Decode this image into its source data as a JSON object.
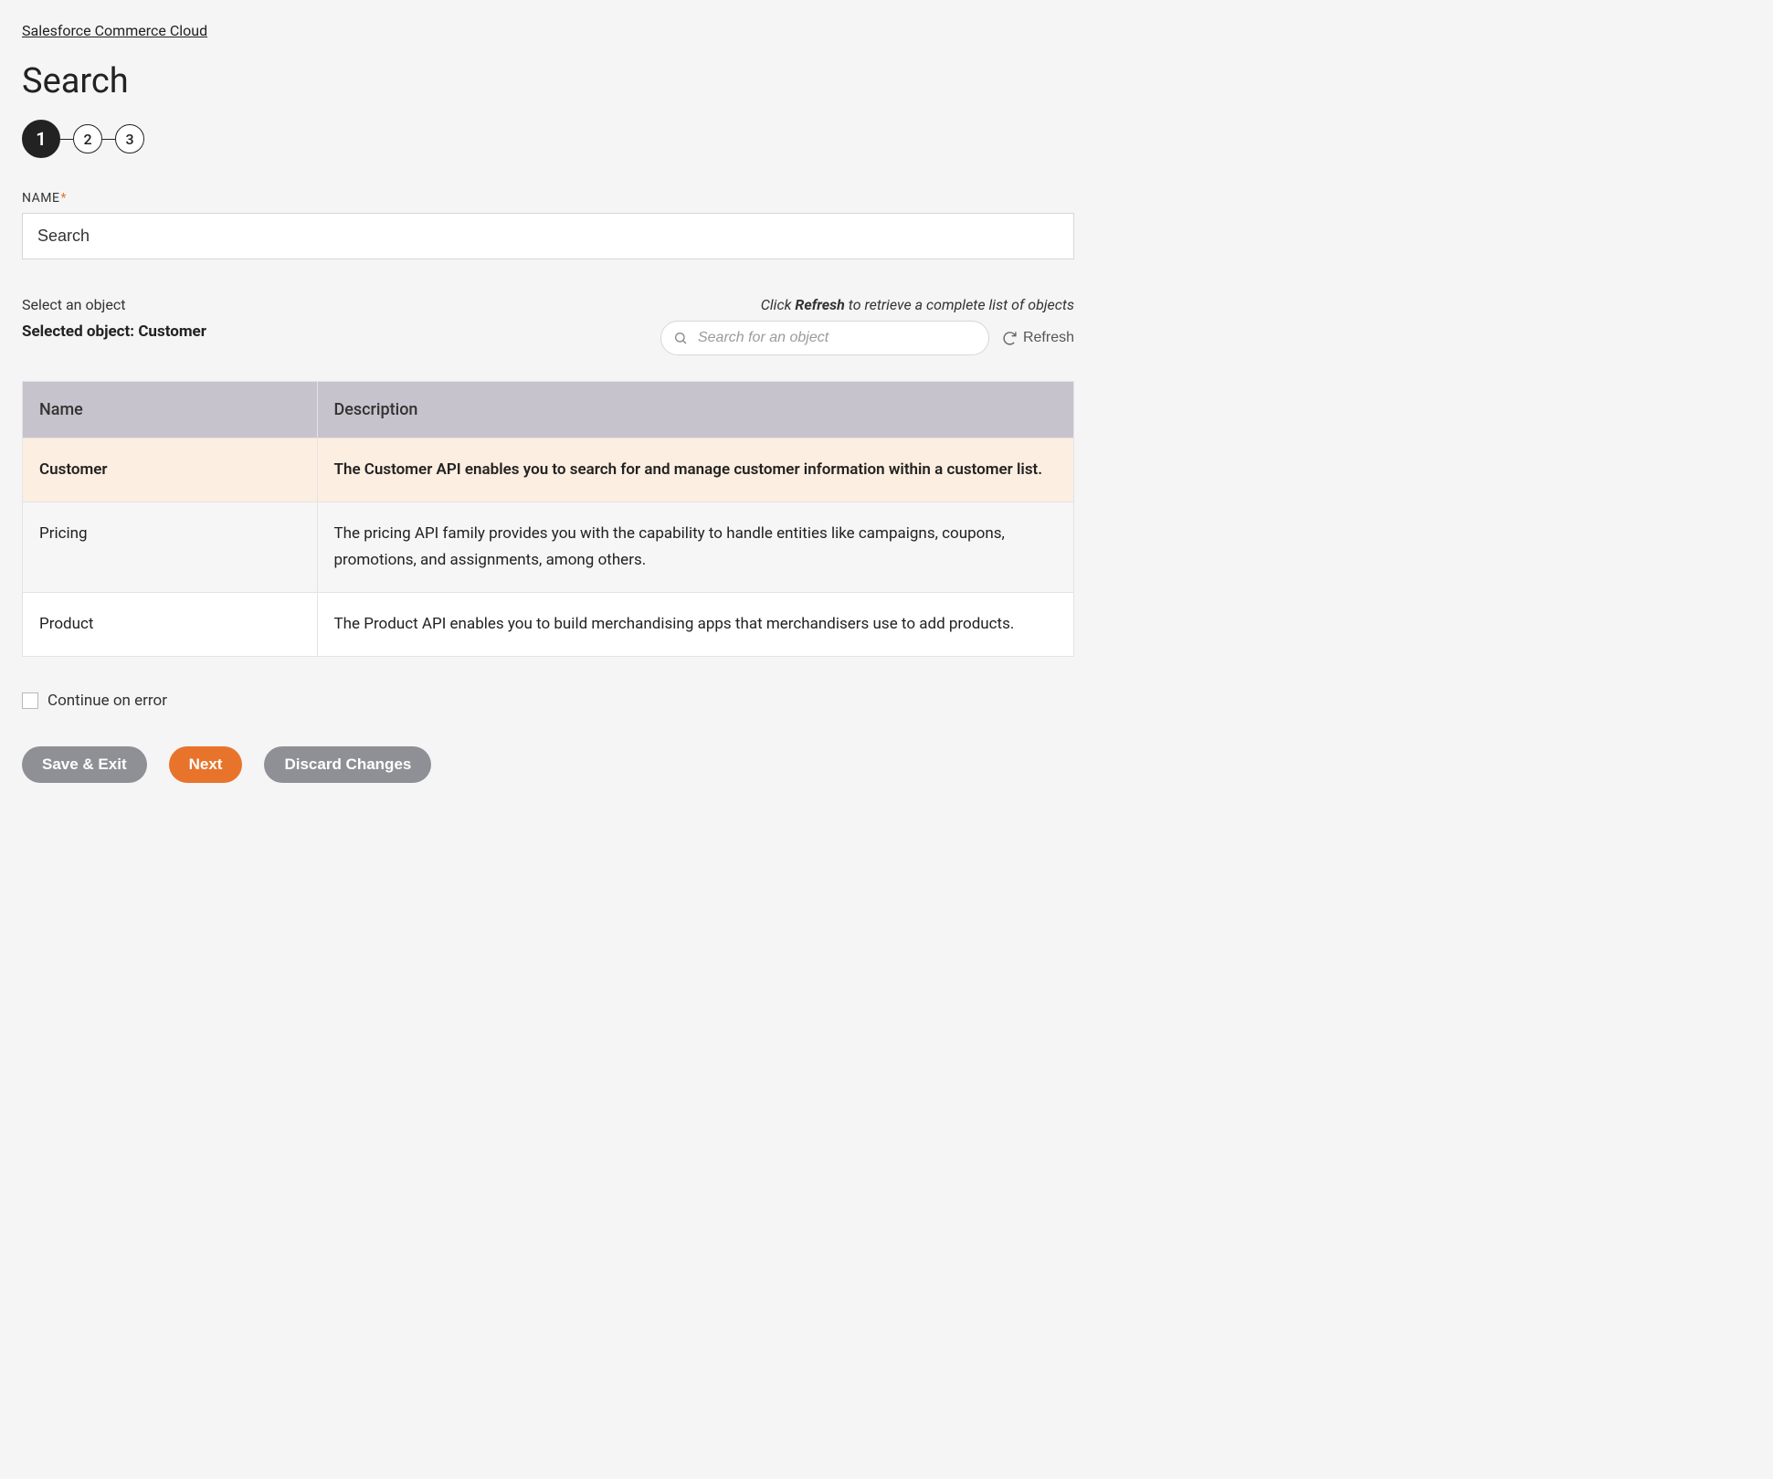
{
  "breadcrumb": "Salesforce Commerce Cloud",
  "page_title": "Search",
  "stepper": {
    "steps": [
      "1",
      "2",
      "3"
    ],
    "active_index": 0
  },
  "name_field": {
    "label": "NAME",
    "required_marker": "*",
    "value": "Search"
  },
  "object_select": {
    "label": "Select an object",
    "refresh_hint_prefix": "Click ",
    "refresh_hint_bold": "Refresh",
    "refresh_hint_suffix": " to retrieve a complete list of objects",
    "selected_prefix": "Selected object: ",
    "selected_value": "Customer",
    "search_placeholder": "Search for an object",
    "refresh_label": "Refresh"
  },
  "table": {
    "headers": {
      "name": "Name",
      "description": "Description"
    },
    "rows": [
      {
        "name": "Customer",
        "description": "The Customer API enables you to search for and manage customer information within a customer list.",
        "selected": true
      },
      {
        "name": "Pricing",
        "description": "The pricing API family provides you with the capability to handle entities like campaigns, coupons, promotions, and assignments, among others.",
        "selected": false
      },
      {
        "name": "Product",
        "description": "The Product API enables you to build merchandising apps that merchandisers use to add products.",
        "selected": false
      }
    ]
  },
  "continue_on_error": {
    "label": "Continue on error",
    "checked": false
  },
  "buttons": {
    "save_exit": "Save & Exit",
    "next": "Next",
    "discard": "Discard Changes"
  }
}
